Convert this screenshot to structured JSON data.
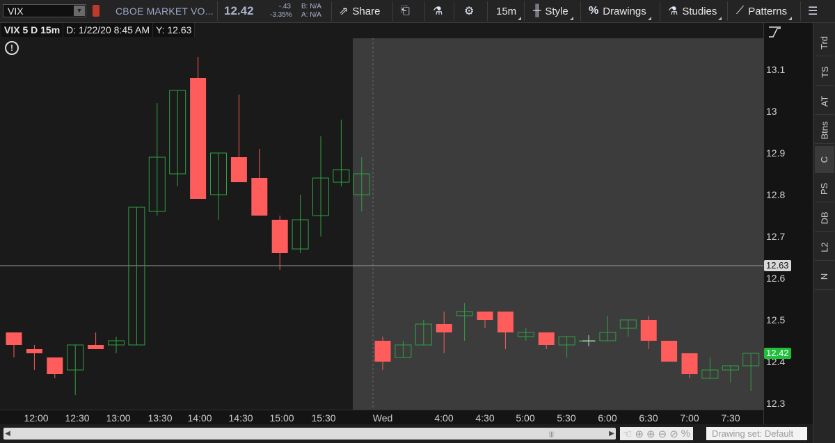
{
  "toolbar": {
    "symbol": "VIX",
    "company": "CBOE MARKET VO...",
    "last_price": "12.42",
    "change": "-.43",
    "change_pct": "-3.35%",
    "bid": "B: N/A",
    "ask": "A: N/A",
    "share_label": "Share",
    "timeframe": "15m",
    "style_label": "Style",
    "drawings_label": "Drawings",
    "studies_label": "Studies",
    "patterns_label": "Patterns"
  },
  "chart_header": {
    "title": "VIX 5 D 15m",
    "date_label": "D: 1/22/20 8:45 AM",
    "y_label": "Y: 12.63"
  },
  "colors": {
    "up": "#2ea043",
    "down": "#ff5c5c",
    "background": "#1a1a1a",
    "after_hours_shade": "#3c3c3c",
    "last_price_tag": "#1fbf3a"
  },
  "chart_data": {
    "type": "candlestick",
    "ylim": [
      12.27,
      13.18
    ],
    "y_ticks": [
      "13.1",
      "13",
      "12.9",
      "12.8",
      "12.7",
      "12.6",
      "12.5",
      "12.4",
      "12.3"
    ],
    "x_ticks": [
      "12:00",
      "12:30",
      "13:00",
      "13:30",
      "14:00",
      "14:30",
      "15:00",
      "15:30",
      "Wed",
      "4:00",
      "4:30",
      "5:00",
      "5:30",
      "6:00",
      "6:30",
      "7:00",
      "7:30"
    ],
    "crosshair_price": "12.63",
    "last_price": "12.42",
    "candles": [
      {
        "o": 12.47,
        "h": 12.47,
        "l": 12.41,
        "c": 12.44
      },
      {
        "o": 12.43,
        "h": 12.44,
        "l": 12.38,
        "c": 12.42
      },
      {
        "o": 12.41,
        "h": 12.41,
        "l": 12.36,
        "c": 12.37
      },
      {
        "o": 12.38,
        "h": 12.44,
        "l": 12.32,
        "c": 12.44
      },
      {
        "o": 12.44,
        "h": 12.47,
        "l": 12.43,
        "c": 12.43
      },
      {
        "o": 12.44,
        "h": 12.46,
        "l": 12.42,
        "c": 12.45
      },
      {
        "o": 12.44,
        "h": 12.77,
        "l": 12.44,
        "c": 12.77
      },
      {
        "o": 12.76,
        "h": 13.02,
        "l": 12.75,
        "c": 12.89
      },
      {
        "o": 12.85,
        "h": 13.05,
        "l": 12.82,
        "c": 13.05
      },
      {
        "o": 13.08,
        "h": 13.13,
        "l": 12.79,
        "c": 12.79
      },
      {
        "o": 12.8,
        "h": 12.9,
        "l": 12.74,
        "c": 12.9
      },
      {
        "o": 12.89,
        "h": 13.04,
        "l": 12.83,
        "c": 12.83
      },
      {
        "o": 12.84,
        "h": 12.91,
        "l": 12.75,
        "c": 12.75
      },
      {
        "o": 12.74,
        "h": 12.75,
        "l": 12.62,
        "c": 12.66
      },
      {
        "o": 12.67,
        "h": 12.8,
        "l": 12.66,
        "c": 12.74
      },
      {
        "o": 12.75,
        "h": 12.94,
        "l": 12.7,
        "c": 12.84
      },
      {
        "o": 12.83,
        "h": 12.98,
        "l": 12.82,
        "c": 12.86
      },
      {
        "o": 12.8,
        "h": 12.89,
        "l": 12.76,
        "c": 12.85
      },
      {
        "o": 12.45,
        "h": 12.46,
        "l": 12.38,
        "c": 12.4
      },
      {
        "o": 12.41,
        "h": 12.45,
        "l": 12.41,
        "c": 12.44
      },
      {
        "o": 12.44,
        "h": 12.5,
        "l": 12.44,
        "c": 12.49
      },
      {
        "o": 12.49,
        "h": 12.52,
        "l": 12.42,
        "c": 12.47
      },
      {
        "o": 12.51,
        "h": 12.54,
        "l": 12.45,
        "c": 12.52
      },
      {
        "o": 12.52,
        "h": 12.52,
        "l": 12.48,
        "c": 12.5
      },
      {
        "o": 12.52,
        "h": 12.52,
        "l": 12.43,
        "c": 12.47
      },
      {
        "o": 12.46,
        "h": 12.48,
        "l": 12.45,
        "c": 12.47
      },
      {
        "o": 12.47,
        "h": 12.47,
        "l": 12.43,
        "c": 12.44
      },
      {
        "o": 12.44,
        "h": 12.46,
        "l": 12.41,
        "c": 12.46
      },
      {
        "o": 12.45,
        "h": 12.45,
        "l": 12.45,
        "c": 12.45
      },
      {
        "o": 12.45,
        "h": 12.51,
        "l": 12.45,
        "c": 12.47
      },
      {
        "o": 12.48,
        "h": 12.5,
        "l": 12.46,
        "c": 12.5
      },
      {
        "o": 12.5,
        "h": 12.51,
        "l": 12.43,
        "c": 12.45
      },
      {
        "o": 12.45,
        "h": 12.45,
        "l": 12.4,
        "c": 12.4
      },
      {
        "o": 12.42,
        "h": 12.42,
        "l": 12.36,
        "c": 12.37
      },
      {
        "o": 12.36,
        "h": 12.41,
        "l": 12.36,
        "c": 12.38
      },
      {
        "o": 12.38,
        "h": 12.39,
        "l": 12.35,
        "c": 12.39
      },
      {
        "o": 12.39,
        "h": 12.42,
        "l": 12.33,
        "c": 12.42
      }
    ]
  },
  "sidebar": {
    "items": [
      "Trd",
      "TS",
      "AT",
      "Btns",
      "C",
      "PS",
      "DB",
      "L2",
      "N"
    ]
  },
  "bottom": {
    "drawing_set": "Drawing set: Default"
  }
}
